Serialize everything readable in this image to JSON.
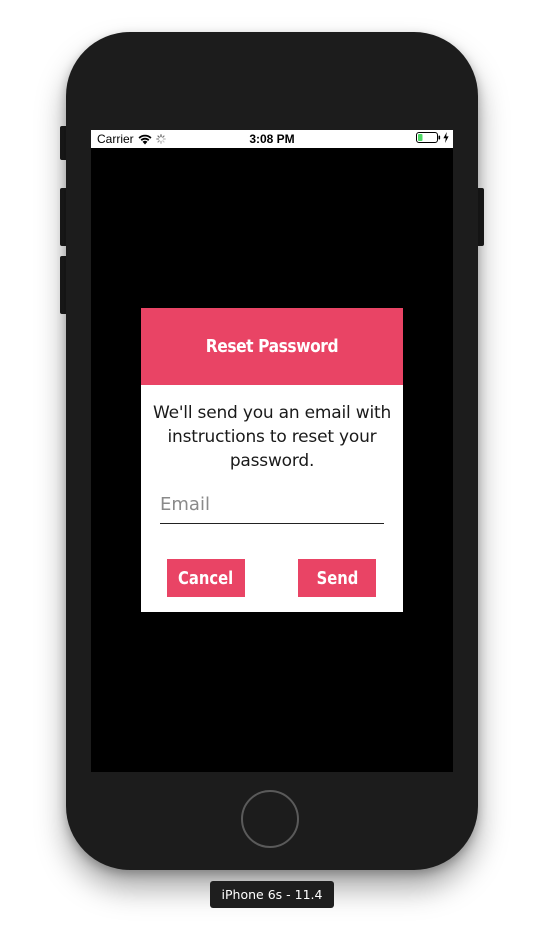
{
  "status_bar": {
    "carrier": "Carrier",
    "time": "3:08 PM",
    "wifi_icon": "wifi-icon",
    "activity_icon": "network-activity-icon",
    "battery_icon": "battery-icon",
    "charging_icon": "charging-bolt-icon"
  },
  "dialog": {
    "title": "Reset Password",
    "message": "We'll send you an email with instructions to reset your password.",
    "email_placeholder": "Email",
    "email_value": "",
    "cancel_label": "Cancel",
    "send_label": "Send"
  },
  "simulator": {
    "device_label": "iPhone 6s - 11.4"
  },
  "colors": {
    "accent": "#e94465",
    "screen_background": "#000000",
    "phone_body": "#1c1c1c"
  }
}
